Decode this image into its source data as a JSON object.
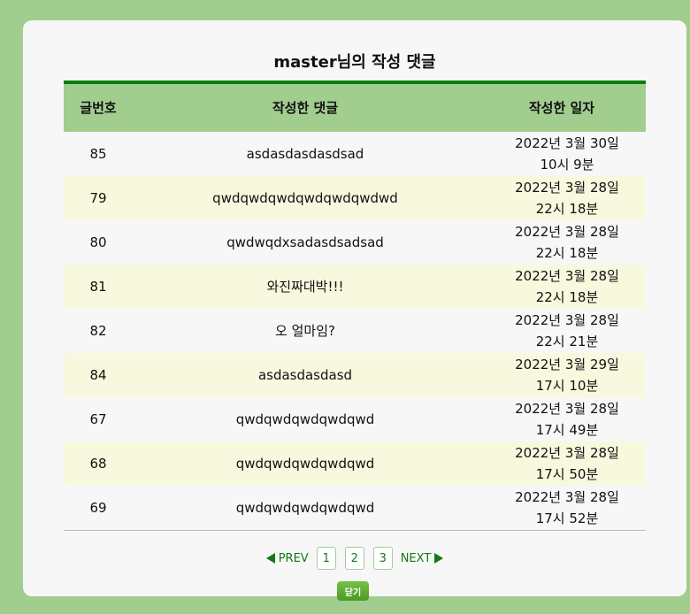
{
  "title": "master님의 작성 댓글",
  "table": {
    "headers": {
      "no": "글번호",
      "comment": "작성한 댓글",
      "date": "작성한 일자"
    },
    "rows": [
      {
        "no": "85",
        "comment": "asdasdasdasdsad",
        "date": "2022년 3월 30일 10시 9분"
      },
      {
        "no": "79",
        "comment": "qwdqwdqwdqwdqwdqwdwd",
        "date": "2022년 3월 28일 22시 18분"
      },
      {
        "no": "80",
        "comment": "qwdwqdxsadasdsadsad",
        "date": "2022년 3월 28일 22시 18분"
      },
      {
        "no": "81",
        "comment": "와진짜대박!!!",
        "date": "2022년 3월 28일 22시 18분"
      },
      {
        "no": "82",
        "comment": "오 얼마임?",
        "date": "2022년 3월 28일 22시 21분"
      },
      {
        "no": "84",
        "comment": "asdasdasdasd",
        "date": "2022년 3월 29일 17시 10분"
      },
      {
        "no": "67",
        "comment": "qwdqwdqwdqwdqwd",
        "date": "2022년 3월 28일 17시 49분"
      },
      {
        "no": "68",
        "comment": "qwdqwdqwdqwdqwd",
        "date": "2022년 3월 28일 17시 50분"
      },
      {
        "no": "69",
        "comment": "qwdqwdqwdqwdqwd",
        "date": "2022년 3월 28일 17시 52분"
      }
    ]
  },
  "pagination": {
    "prev": "PREV",
    "next": "NEXT",
    "pages": [
      "1",
      "2",
      "3"
    ]
  },
  "close_label": "닫기",
  "colors": {
    "background": "#a1cd8f",
    "accent": "#0b7d0b",
    "row_alt": "#f7f8dd"
  }
}
